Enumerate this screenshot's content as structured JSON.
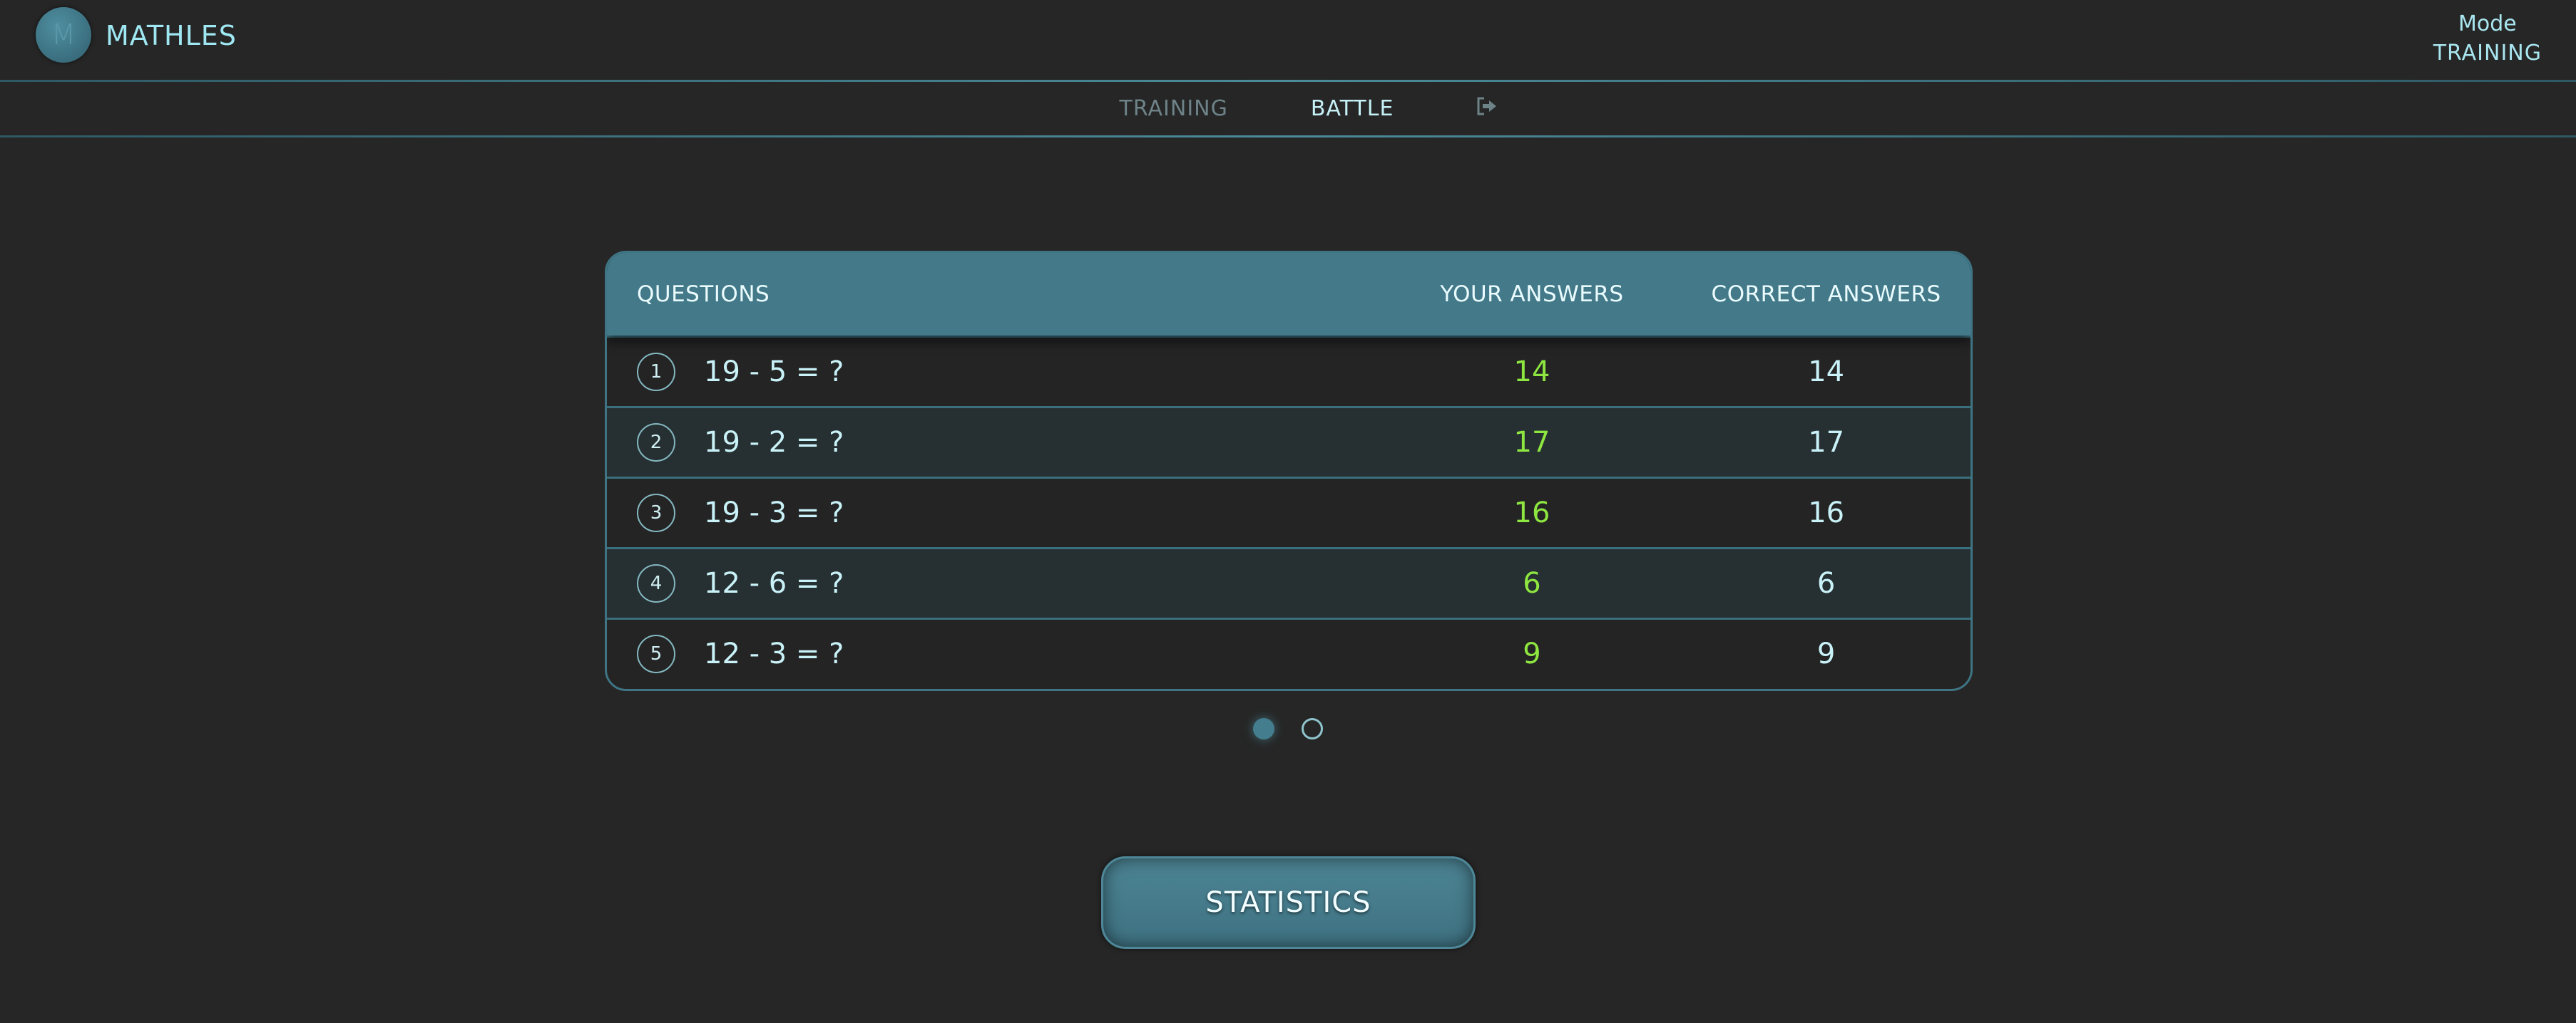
{
  "header": {
    "logo_letter": "M",
    "brand": "MATHLES",
    "mode_label": "Mode",
    "mode_value": "TRAINING"
  },
  "nav": {
    "items": [
      {
        "label": "TRAINING",
        "active": false
      },
      {
        "label": "BATTLE",
        "active": true
      }
    ],
    "exit_icon": "sign-out-icon"
  },
  "table": {
    "headers": {
      "questions": "QUESTIONS",
      "your_answers": "YOUR ANSWERS",
      "correct_answers": "CORRECT ANSWERS"
    },
    "rows": [
      {
        "index": "1",
        "question": "19 - 5 = ?",
        "your": "14",
        "correct": "14"
      },
      {
        "index": "2",
        "question": "19 - 2 = ?",
        "your": "17",
        "correct": "17"
      },
      {
        "index": "3",
        "question": "19 - 3 = ?",
        "your": "16",
        "correct": "16"
      },
      {
        "index": "4",
        "question": "12 - 6 = ?",
        "your": "6",
        "correct": "6"
      },
      {
        "index": "5",
        "question": "12 - 3 = ?",
        "your": "9",
        "correct": "9"
      }
    ]
  },
  "pagination": {
    "pages": 2,
    "current": 1
  },
  "statistics_button": "STATISTICS",
  "colors": {
    "background": "#262626",
    "accent": "#437989",
    "your_answer": "#8ee640",
    "text": "#c9f2f8"
  }
}
